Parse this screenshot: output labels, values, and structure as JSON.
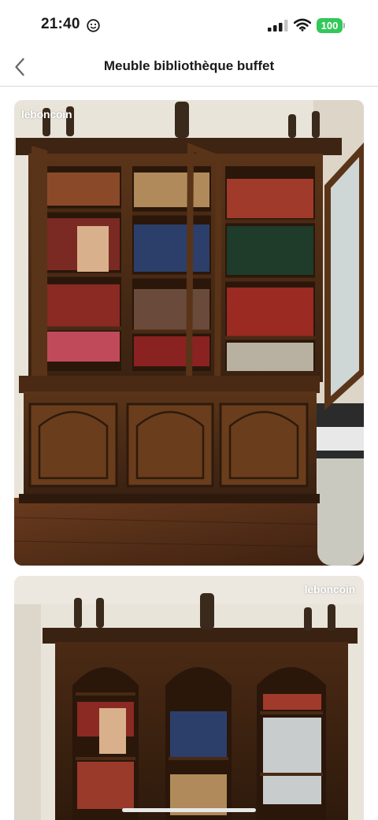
{
  "status_bar": {
    "time": "21:40",
    "battery_level": "100",
    "icons": [
      "focus-smiley-icon",
      "cellular-signal-icon",
      "wifi-icon",
      "battery-icon"
    ],
    "battery_color": "#34c759"
  },
  "nav": {
    "back_icon": "chevron-left-icon",
    "title": "Meuble bibliothèque buffet"
  },
  "photos": [
    {
      "watermark": "leboncoin",
      "alt": "bookcase-buffet-photo-1"
    },
    {
      "watermark": "leboncoin",
      "alt": "bookcase-buffet-photo-2"
    }
  ],
  "colors": {
    "wood_dark": "#3a2212",
    "wood_mid": "#5a3418",
    "wood_light": "#7a4a24",
    "wall": "#e9e4da",
    "accent_divider": "#d9d9d9"
  }
}
